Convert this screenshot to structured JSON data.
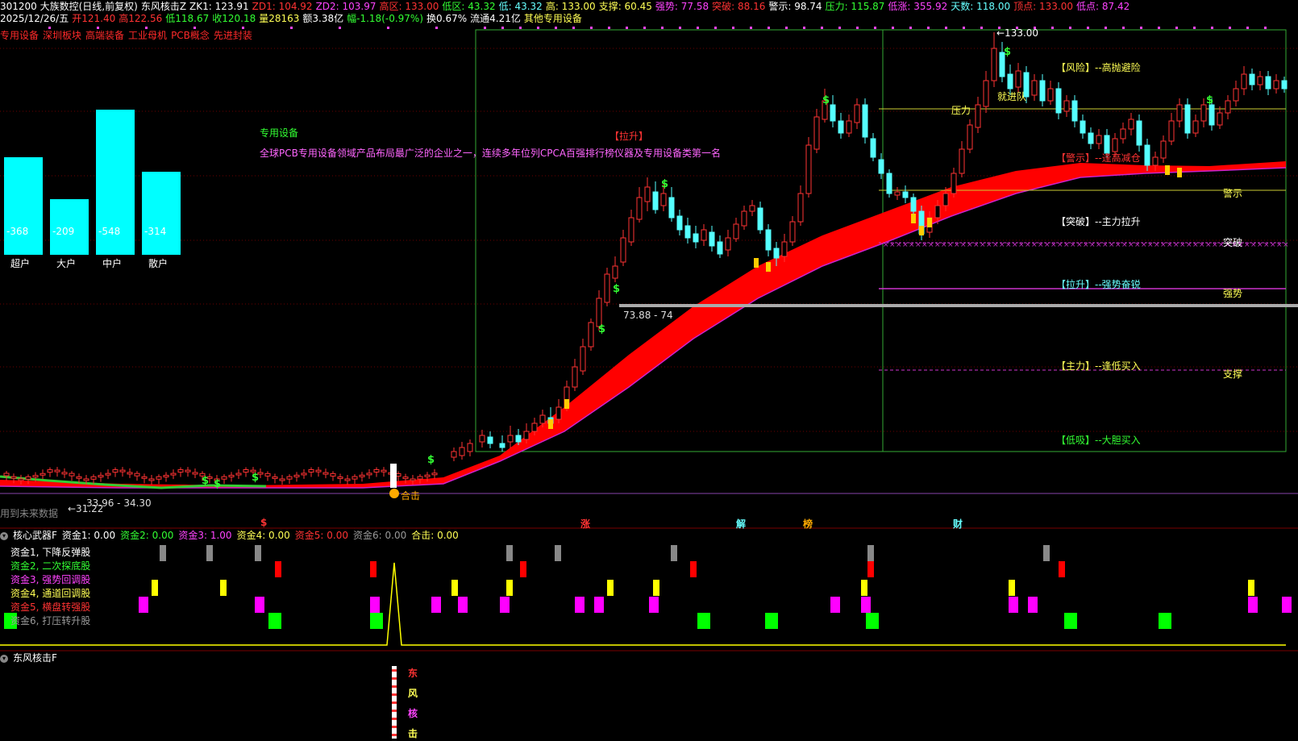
{
  "header": {
    "row1": [
      {
        "text": "301200 大族数控(日线,前复权)",
        "color": "#ffffff"
      },
      {
        "text": "东风核击Z",
        "color": "#ffffff"
      },
      {
        "text": "ZK1: 123.91",
        "color": "#ffffff"
      },
      {
        "text": "ZD1: 104.92",
        "color": "#ff3333"
      },
      {
        "text": "ZD2: 103.97",
        "color": "#ff44ff"
      },
      {
        "text": "高区: 133.00",
        "color": "#ff3333"
      },
      {
        "text": "低区: 43.32",
        "color": "#33ff33"
      },
      {
        "text": "低: 43.32",
        "color": "#66ffff"
      },
      {
        "text": "高: 133.00",
        "color": "#ffff55"
      },
      {
        "text": "支撑: 60.45",
        "color": "#ffff55"
      },
      {
        "text": "强势: 77.58",
        "color": "#ff44ff"
      },
      {
        "text": "突破: 88.16",
        "color": "#ff3333"
      },
      {
        "text": "警示: 98.74",
        "color": "#ffffff"
      },
      {
        "text": "压力: 115.87",
        "color": "#33ff33"
      },
      {
        "text": "低涨: 355.92",
        "color": "#ff44ff"
      },
      {
        "text": "天数: 118.00",
        "color": "#66ffff"
      },
      {
        "text": "顶点: 133.00",
        "color": "#ff3333"
      },
      {
        "text": "低点: 87.42",
        "color": "#ff44ff"
      }
    ],
    "row2": [
      {
        "text": "2025/12/26/五",
        "color": "#ffffff"
      },
      {
        "text": "开121.40",
        "color": "#ff3333"
      },
      {
        "text": "高122.56",
        "color": "#ff3333"
      },
      {
        "text": "低118.67",
        "color": "#33ff33"
      },
      {
        "text": "收120.18",
        "color": "#33ff33"
      },
      {
        "text": "量28163",
        "color": "#ffff55"
      },
      {
        "text": "额3.38亿",
        "color": "#ffffff"
      },
      {
        "text": "幅-1.18(-0.97%)",
        "color": "#33ff33"
      },
      {
        "text": "换0.67%",
        "color": "#ffffff"
      },
      {
        "text": "流通4.21亿",
        "color": "#ffffff"
      },
      {
        "text": "其他专用设备",
        "color": "#ffff55"
      }
    ],
    "tags": [
      "专用设备",
      "深圳板块",
      "高端装备",
      "工业母机",
      "PCB概念",
      "先进封装"
    ]
  },
  "fund_bars": [
    {
      "label": "超户",
      "value": -368
    },
    {
      "label": "大户",
      "value": -209
    },
    {
      "label": "中户",
      "value": -548
    },
    {
      "label": "散户",
      "value": -314
    }
  ],
  "chart": {
    "sector_title": "专用设备",
    "description": "全球PCB专用设备领域产品布局最广泛的企业之一，连续多年位列CPCA百强排行榜仪器及专用设备类第一名",
    "pullup_label": "【拉升】",
    "top_price": "←133.00",
    "low_price": "←31.22",
    "range_low": "33.96 - 34.30",
    "range_mid": "73.88 - 74",
    "future_data": "用到未来数据",
    "hit_label": "合击",
    "pressure_label": "压力",
    "signal_label": "就进队",
    "legend": [
      {
        "text": "【风险】--高抛避险",
        "color": "#ffff55"
      },
      {
        "text": "【警示】--逢高减仓",
        "color": "#ff3333"
      },
      {
        "text": "【突破】--主力拉升",
        "color": "#ffffff"
      },
      {
        "text": "【拉升】--强势奋锐",
        "color": "#66ffff"
      },
      {
        "text": "【主力】--逢低买入",
        "color": "#ffff55"
      },
      {
        "text": "【低吸】--大胆买入",
        "color": "#33ff33"
      }
    ],
    "levels": [
      {
        "label": "警示",
        "color": "#ffff55"
      },
      {
        "label": "突破",
        "color": "#ffffff"
      },
      {
        "label": "强势",
        "color": "#ffff55"
      },
      {
        "label": "支撑",
        "color": "#ffff55"
      }
    ],
    "dollar": "$",
    "markers": [
      {
        "text": "$",
        "color": "#ff3333"
      },
      {
        "text": "涨",
        "color": "#ff3333"
      },
      {
        "text": "解",
        "color": "#66ffff"
      },
      {
        "text": "榜",
        "color": "#ffaa00"
      },
      {
        "text": "财",
        "color": "#66ffff"
      }
    ]
  },
  "panel2": {
    "title": "核心武器F",
    "values": [
      {
        "text": "资金1: 0.00",
        "color": "#ffffff"
      },
      {
        "text": "资金2: 0.00",
        "color": "#33ff33"
      },
      {
        "text": "资金3: 1.00",
        "color": "#ff44ff"
      },
      {
        "text": "资金4: 0.00",
        "color": "#ffff55"
      },
      {
        "text": "资金5: 0.00",
        "color": "#ff3333"
      },
      {
        "text": "资金6: 0.00",
        "color": "#999999"
      },
      {
        "text": "合击: 0.00",
        "color": "#ffff55"
      }
    ],
    "funds": [
      {
        "text": "资金1, 下降反弹股",
        "color": "#ffffff"
      },
      {
        "text": "资金2, 二次探底股",
        "color": "#33ff33"
      },
      {
        "text": "资金3, 强势回调股",
        "color": "#ff44ff"
      },
      {
        "text": "资金4, 通道回调股",
        "color": "#ffff55"
      },
      {
        "text": "资金5, 横盘转强股",
        "color": "#ff3333"
      },
      {
        "text": "资金6, 打压转升股",
        "color": "#999999"
      }
    ]
  },
  "panel3": {
    "title": "东风核击F",
    "chars": [
      "东",
      "风",
      "核",
      "击"
    ]
  }
}
